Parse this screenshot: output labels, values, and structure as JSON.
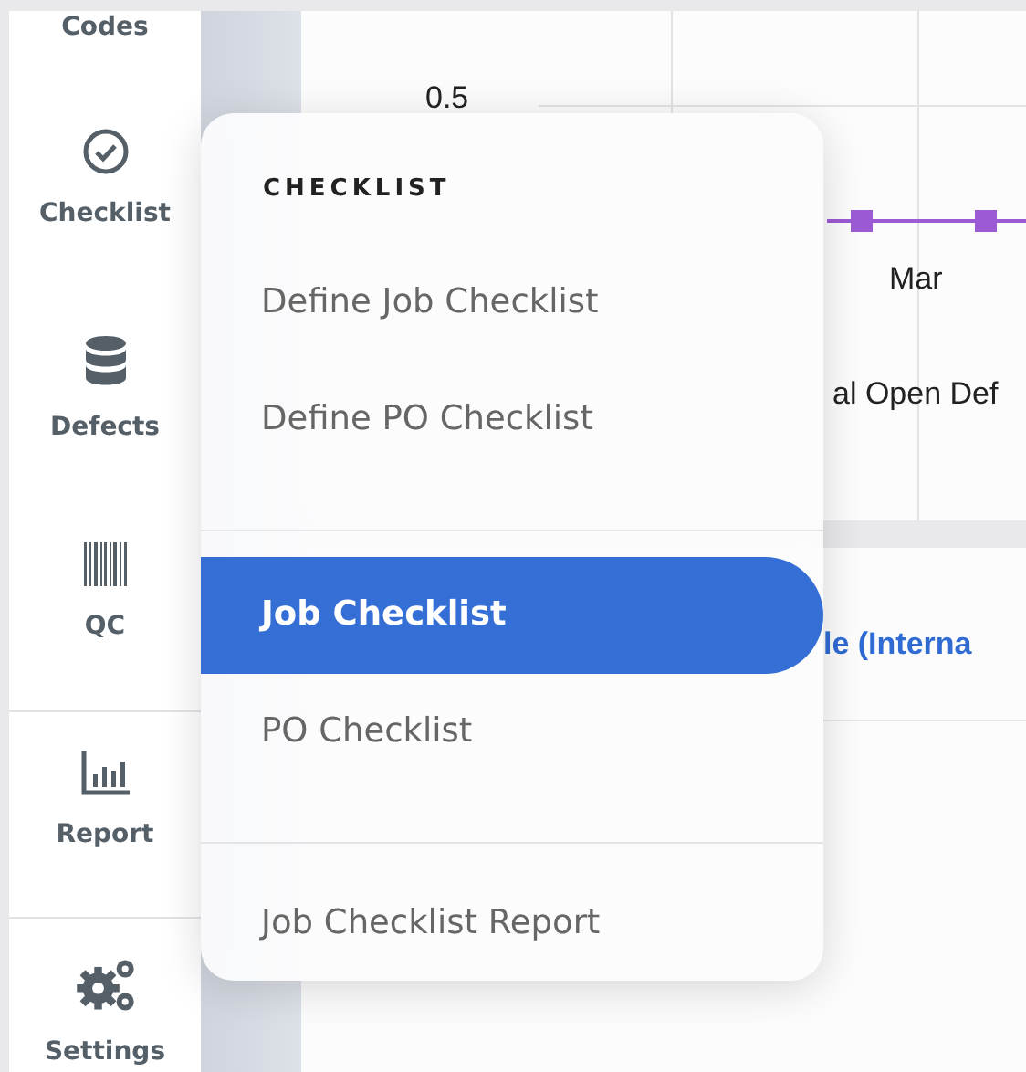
{
  "sidebar": {
    "items": [
      {
        "label": "Codes",
        "kind": "none",
        "separated": false
      },
      {
        "label": "Checklist",
        "kind": "check",
        "separated": false
      },
      {
        "label": "Defects",
        "kind": "database",
        "separated": false
      },
      {
        "label": "QC",
        "kind": "barcode",
        "separated": false
      },
      {
        "label": "Report",
        "kind": "chart",
        "separated": true
      },
      {
        "label": "Settings",
        "kind": "gears",
        "separated": true
      }
    ]
  },
  "chart_panel": {
    "y_tick": "0.5",
    "x_label": "Mar",
    "legend": "al Open Def"
  },
  "table_panel": {
    "title": "le (Interna"
  },
  "menu": {
    "title": "CHECKLIST",
    "groups": [
      [
        {
          "label": "Define Job Checklist",
          "selected": false
        },
        {
          "label": "Define PO Checklist",
          "selected": false
        }
      ],
      [
        {
          "label": "Job Checklist",
          "selected": true
        },
        {
          "label": "PO Checklist",
          "selected": false
        }
      ],
      [
        {
          "label": "Job Checklist Report",
          "selected": false
        }
      ]
    ]
  }
}
